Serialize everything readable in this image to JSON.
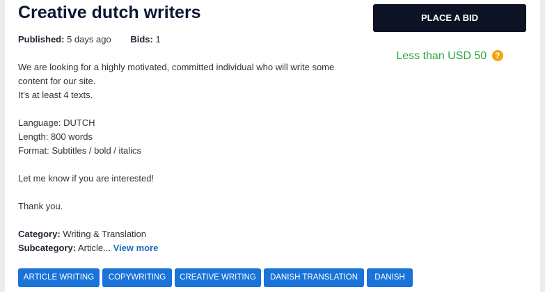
{
  "job": {
    "title": "Creative dutch writers",
    "published_label": "Published:",
    "published_value": "5 days ago",
    "bids_label": "Bids:",
    "bids_value": "1",
    "description": [
      "We are looking for a highly motivated, committed individual who will write some",
      "content for our site.",
      "It's at least 4 texts.",
      "",
      "Language: DUTCH",
      "Length: 800 words",
      "Format: Subtitles / bold / italics",
      "",
      "Let me know if you are interested!",
      "",
      "Thank you."
    ],
    "category_label": "Category:",
    "category_value": "Writing & Translation",
    "subcategory_label": "Subcategory:",
    "subcategory_value": "Article...",
    "view_more_label": "View more"
  },
  "tags": [
    "ARTICLE WRITING",
    "COPYWRITING",
    "CREATIVE WRITING",
    "DANISH TRANSLATION",
    "DANISH"
  ],
  "sidebar": {
    "bid_button_label": "PLACE A BID",
    "budget_text": "Less than USD 50",
    "budget_help_icon": "?"
  },
  "colors": {
    "title": "#0b1733",
    "bid_button_bg": "#0d1324",
    "budget_text": "#2bab3c",
    "help_icon": "#f1a50d",
    "tag_bg": "#1a73d9",
    "link": "#1a6cc8"
  }
}
